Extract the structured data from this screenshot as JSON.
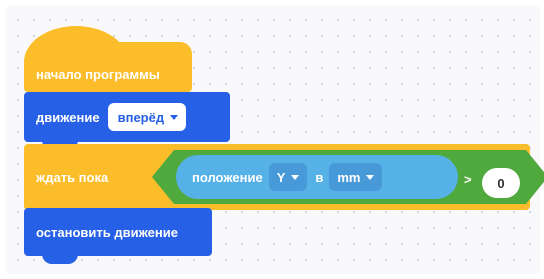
{
  "blocks": {
    "start": {
      "label": "начало программы"
    },
    "move": {
      "label": "движение",
      "direction": "вперёд"
    },
    "wait": {
      "label": "ждать пока",
      "sensor_label": "положение",
      "axis": "Y",
      "connector": "в",
      "unit": "mm",
      "operator": ">",
      "value": "0"
    },
    "stop": {
      "label": "остановить движение"
    }
  },
  "colors": {
    "control": "#fbbd2a",
    "motion": "#2660e6",
    "operator": "#50a93d",
    "sensor": "#56b2e6"
  }
}
